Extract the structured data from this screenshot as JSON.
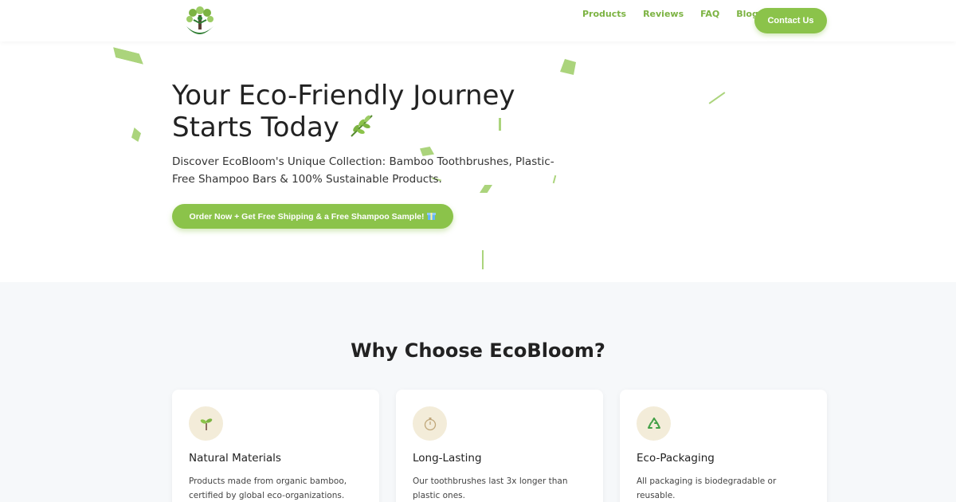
{
  "nav": {
    "logo_icon": "tree-person-logo",
    "links": [
      "Products",
      "Reviews",
      "FAQ",
      "Blog"
    ],
    "contact_label": "Contact Us"
  },
  "hero": {
    "title_line1": "Your Eco-Friendly Journey",
    "title_line2": "Starts Today",
    "title_icon": "herb-leaf-icon",
    "subtitle": "Discover EcoBloom's Unique Collection: Bamboo Toothbrushes, Plastic-Free Shampoo Bars & 100% Sustainable Products.",
    "cta_label": "Order Now + Get Free Shipping & a Free Shampoo Sample!",
    "cta_icon": "gift-icon"
  },
  "why": {
    "title": "Why Choose EcoBloom?",
    "cards": [
      {
        "icon": "seedling-icon",
        "title": "Natural Materials",
        "text": "Products made from organic bamboo, certified by global eco-organizations."
      },
      {
        "icon": "stopwatch-icon",
        "title": "Long-Lasting",
        "text": "Our toothbrushes last 3x longer than plastic ones."
      },
      {
        "icon": "recycle-icon",
        "title": "Eco-Packaging",
        "text": "All packaging is biodegradable or reusable."
      }
    ]
  },
  "colors": {
    "accent": "#8bc34a",
    "accent_text": "#7cb342",
    "icon_bg": "#f3ecd9",
    "section_bg": "#f6f8fa"
  }
}
